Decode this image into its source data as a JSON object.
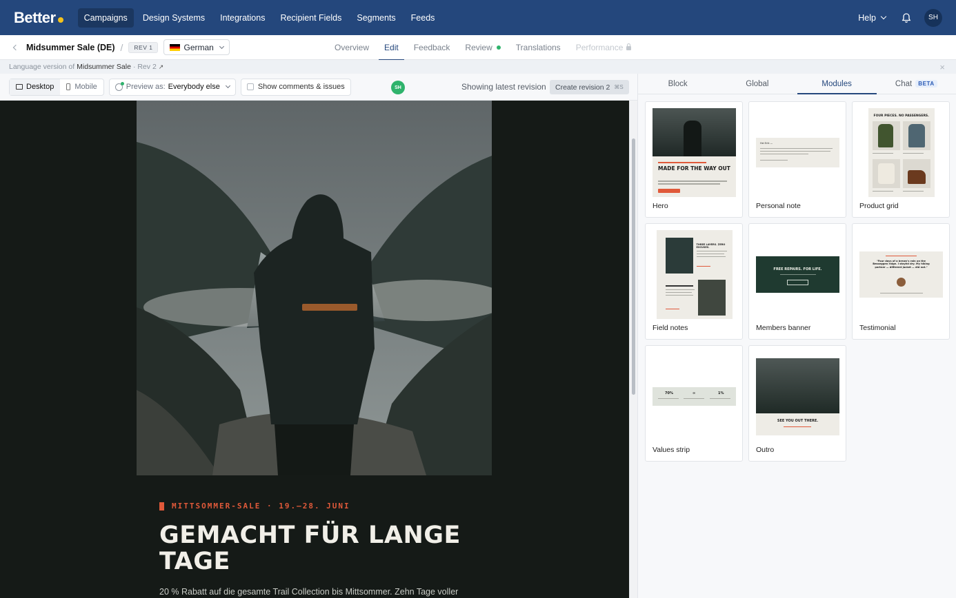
{
  "nav": {
    "logo": "Better",
    "links": [
      "Campaigns",
      "Design Systems",
      "Integrations",
      "Recipient Fields",
      "Segments",
      "Feeds"
    ],
    "active": "Campaigns",
    "help": "Help",
    "avatar": "SH"
  },
  "subheader": {
    "campaign_name": "Midsummer Sale (DE)",
    "separator": "/",
    "revision": "REV 1",
    "language": "German",
    "tabs": [
      "Overview",
      "Edit",
      "Feedback",
      "Review",
      "Translations",
      "Performance"
    ],
    "active_tab": "Edit"
  },
  "infobar": {
    "prefix": "Language version of",
    "parent": "Midsummer Sale",
    "rev": "· Rev 2",
    "ext": "↗",
    "close": "×"
  },
  "toolbar": {
    "desktop": "Desktop",
    "mobile": "Mobile",
    "preview_label": "Preview as:",
    "preview_value": "Everybody else",
    "comments": "Show comments & issues",
    "user": "SH",
    "latest": "Showing latest revision",
    "create": "Create revision 2",
    "shortcut": "⌘S"
  },
  "email": {
    "eyebrow": "MITTSOMMER-SALE · 19.–28. JUNI",
    "headline": "GEMACHT FÜR LANGE TAGE",
    "body": "20 % Rabatt auf die gesamte Trail Collection bis Mittsommer. Zehn Tage voller"
  },
  "panel": {
    "tabs": [
      "Block",
      "Global",
      "Modules",
      "Chat"
    ],
    "active_tab": "Modules",
    "beta": "BETA",
    "modules": [
      {
        "name": "Hero",
        "heading": "MADE FOR THE WAY OUT"
      },
      {
        "name": "Personal note",
        "heading": "Hei Erik —"
      },
      {
        "name": "Product grid",
        "heading": "FOUR PIECES. NO PASSENGERS."
      },
      {
        "name": "Field notes",
        "heading": "THREE LAYERS. ZERO EXCUSES."
      },
      {
        "name": "Members banner",
        "heading": "FREE REPAIRS. FOR LIFE."
      },
      {
        "name": "Testimonial",
        "heading": "\"Four days of a brewy's rain on the Besseggen ridge. I stayed dry. My hiking partner — different jacket — did not.\""
      },
      {
        "name": "Values strip",
        "stats": [
          "70%",
          "∞",
          "1%"
        ]
      },
      {
        "name": "Outro",
        "heading": "SEE YOU OUT THERE."
      }
    ]
  },
  "colors": {
    "nav_bg": "#24477c",
    "accent_orange": "#e0593a",
    "canvas_bg": "#151a17",
    "status_green": "#2fb36c",
    "logo_dot": "#f5c21b"
  }
}
